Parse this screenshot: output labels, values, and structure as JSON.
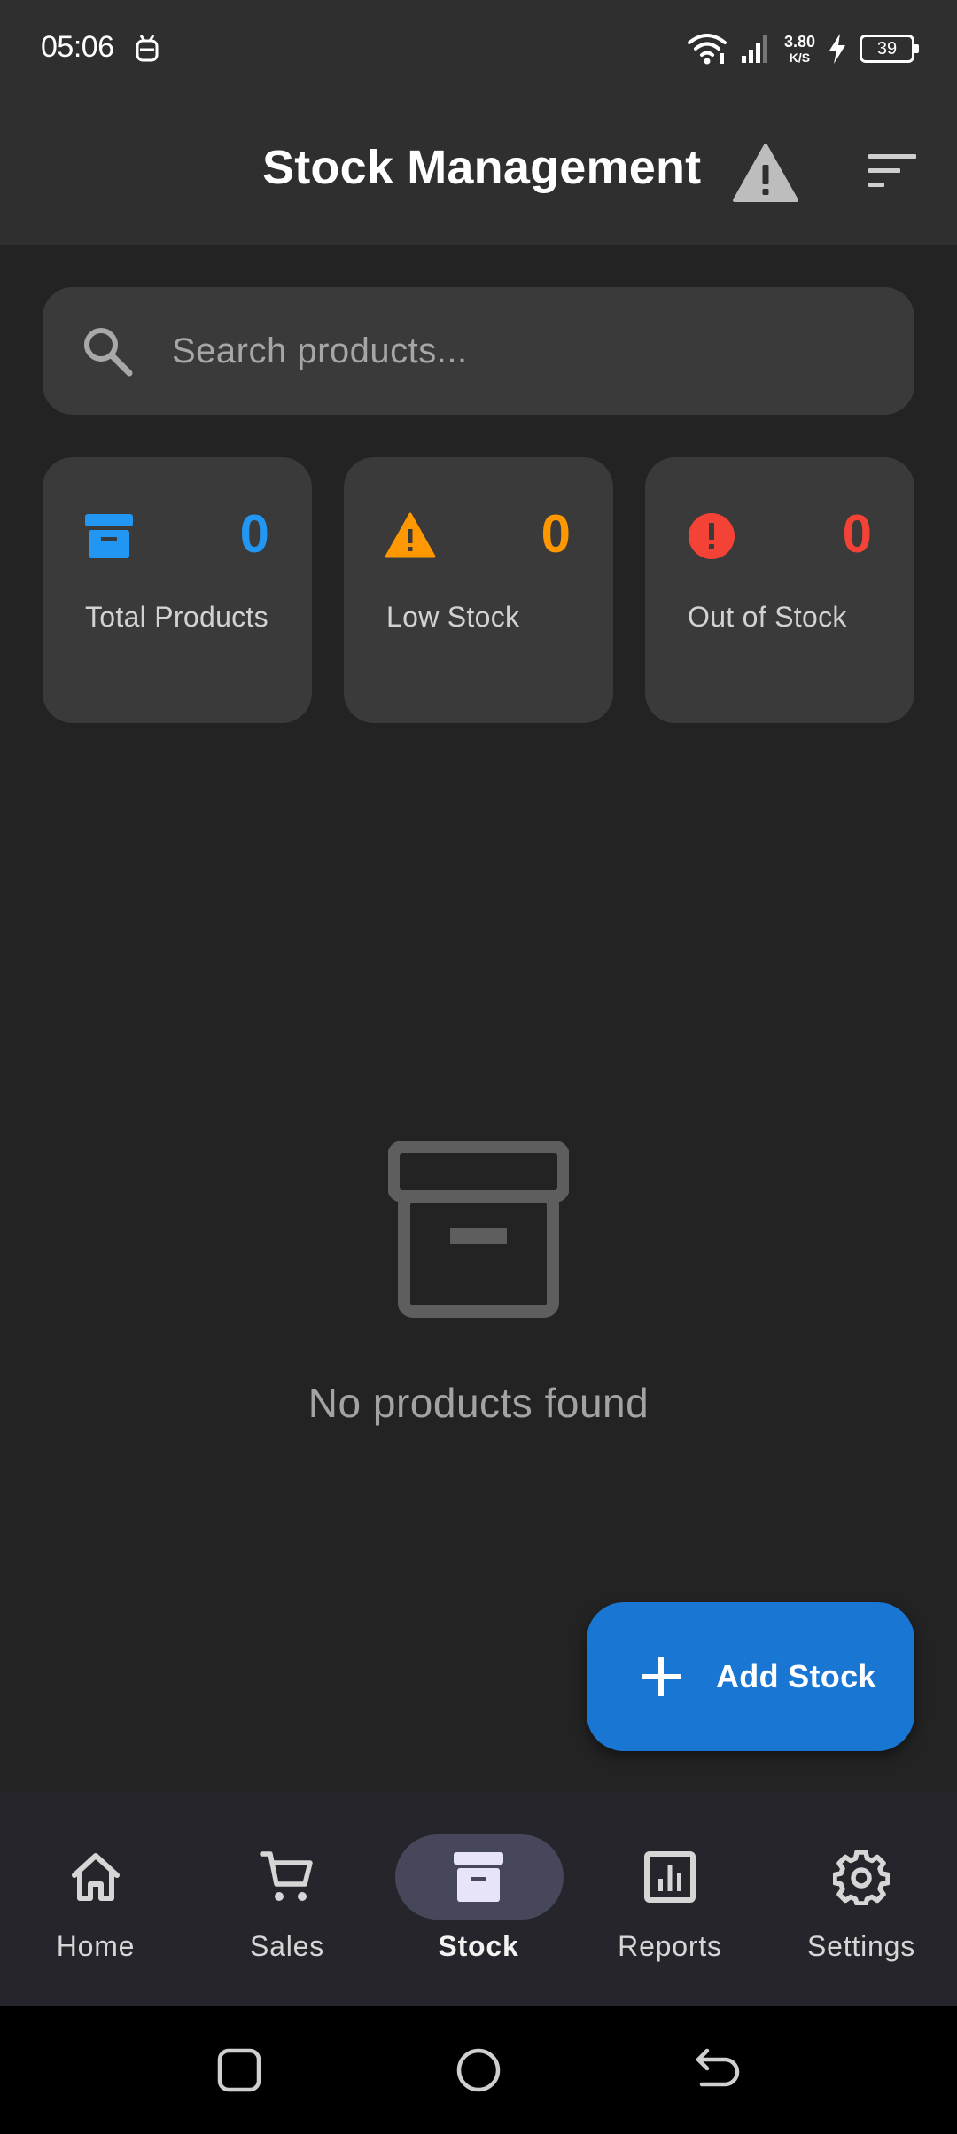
{
  "status_bar": {
    "time": "05:06",
    "net_speed_value": "3.80",
    "net_speed_unit": "K/S",
    "battery": "39"
  },
  "app_bar": {
    "title": "Stock Management"
  },
  "search": {
    "placeholder": "Search products..."
  },
  "stats": [
    {
      "value": "0",
      "label": "Total Products",
      "color": "#2196f3",
      "icon": "inventory-icon"
    },
    {
      "value": "0",
      "label": "Low Stock",
      "color": "#ff9800",
      "icon": "warning-icon"
    },
    {
      "value": "0",
      "label": "Out of Stock",
      "color": "#f44336",
      "icon": "error-icon"
    }
  ],
  "empty_state": {
    "message": "No products found",
    "icon": "inventory-icon"
  },
  "fab": {
    "label": "Add Stock",
    "color": "#1976d2"
  },
  "bottom_nav": {
    "items": [
      {
        "label": "Home",
        "icon": "home-icon",
        "active": false
      },
      {
        "label": "Sales",
        "icon": "cart-icon",
        "active": false
      },
      {
        "label": "Stock",
        "icon": "inventory-icon",
        "active": true
      },
      {
        "label": "Reports",
        "icon": "chart-icon",
        "active": false
      },
      {
        "label": "Settings",
        "icon": "gear-icon",
        "active": false
      }
    ]
  },
  "system_nav": {
    "buttons": [
      "recents",
      "home",
      "back"
    ]
  }
}
